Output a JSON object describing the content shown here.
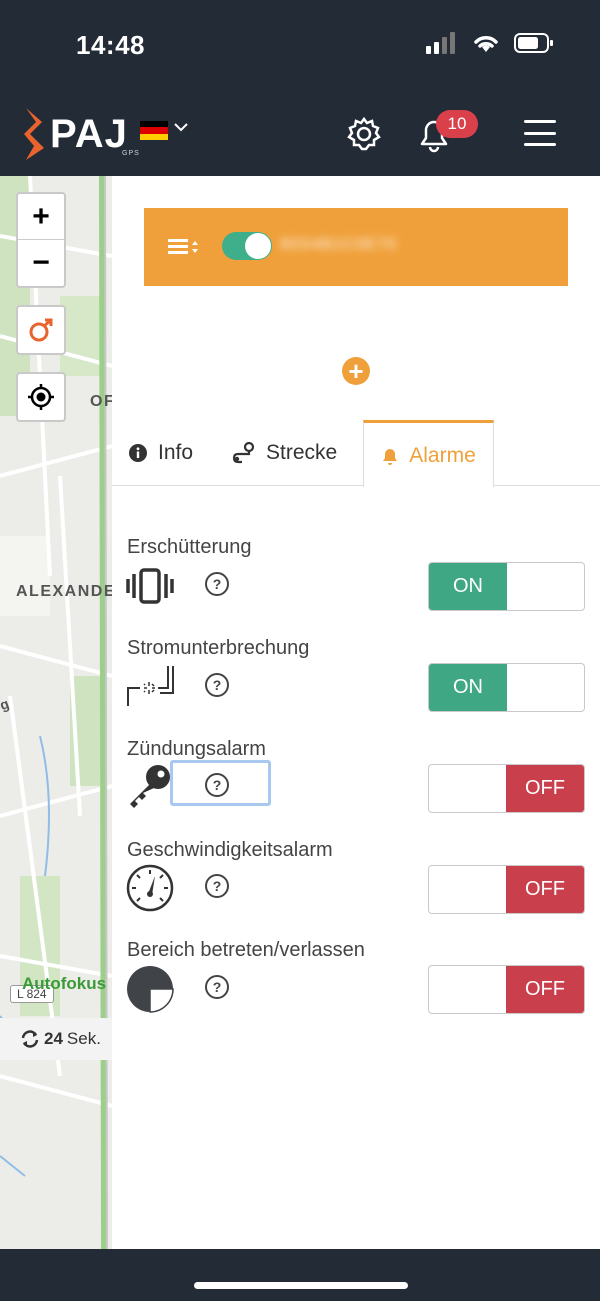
{
  "status_bar": {
    "time": "14:48"
  },
  "header": {
    "logo_text": "PAJ",
    "logo_sub": "GPS",
    "notification_count": "10",
    "colors": {
      "background": "#232b36",
      "badge": "#d9404a"
    }
  },
  "map": {
    "zoom_in": "+",
    "zoom_out": "−",
    "labels": [
      "OF",
      "ALEXANDE",
      "g"
    ],
    "road_badge": "L 824",
    "autofokus": "Autofokus",
    "refresh_value": "24",
    "refresh_unit": "Sek."
  },
  "device": {
    "number": "80S4B1C0E70",
    "active": true,
    "color": "#f0a03a"
  },
  "tabs": [
    {
      "label": "Info",
      "icon": "info-icon",
      "active": false
    },
    {
      "label": "Strecke",
      "icon": "route-icon",
      "active": false
    },
    {
      "label": "Alarme",
      "icon": "bell-icon",
      "active": true
    }
  ],
  "alarms": [
    {
      "title": "Erschütterung",
      "icon": "vibration-icon",
      "help": "?",
      "state": "ON"
    },
    {
      "title": "Stromunterbrechung",
      "icon": "power-cut-icon",
      "help": "?",
      "state": "ON"
    },
    {
      "title": "Zündungsalarm",
      "icon": "key-icon",
      "help": "?",
      "state": "OFF"
    },
    {
      "title": "Geschwindigkeitsalarm",
      "icon": "speedometer-icon",
      "help": "?",
      "state": "OFF"
    },
    {
      "title": "Bereich betreten/verlassen",
      "icon": "geofence-icon",
      "help": "?",
      "state": "OFF"
    }
  ],
  "switch_colors": {
    "on": "#3fa784",
    "off": "#c9404c"
  }
}
